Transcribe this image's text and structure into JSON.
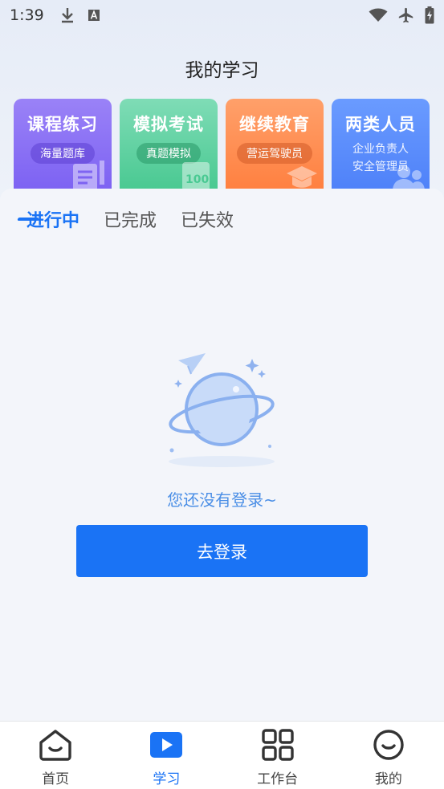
{
  "status_bar": {
    "time": "1:39"
  },
  "header": {
    "title": "我的学习"
  },
  "cards": [
    {
      "title": "课程练习",
      "chip": "海量题库",
      "color": "#7a5ff2",
      "deco": "document-pencil-icon"
    },
    {
      "title": "模拟考试",
      "chip": "真题模拟",
      "color": "#44c78e",
      "deco": "score-100-icon"
    },
    {
      "title": "继续教育",
      "chip": "营运驾驶员",
      "color": "#ff7d3c",
      "deco": "graduation-cap-icon"
    },
    {
      "title": "两类人员",
      "sub1": "企业负责人",
      "sub2": "安全管理员",
      "color": "#4c7ff8",
      "deco": "people-icon"
    }
  ],
  "tabs": [
    {
      "label": "进行中",
      "active": true
    },
    {
      "label": "已完成",
      "active": false
    },
    {
      "label": "已失效",
      "active": false
    }
  ],
  "empty_state": {
    "message": "您还没有登录~",
    "button_label": "去登录",
    "icon": "planet-icon"
  },
  "bottom_nav": [
    {
      "label": "首页",
      "icon": "home-icon",
      "active": false
    },
    {
      "label": "学习",
      "icon": "play-icon",
      "active": true
    },
    {
      "label": "工作台",
      "icon": "grid-icon",
      "active": false
    },
    {
      "label": "我的",
      "icon": "smile-icon",
      "active": false
    }
  ],
  "colors": {
    "accent": "#1a73f5",
    "empty_text": "#4a8ee6",
    "background": "#f3f5fa"
  }
}
